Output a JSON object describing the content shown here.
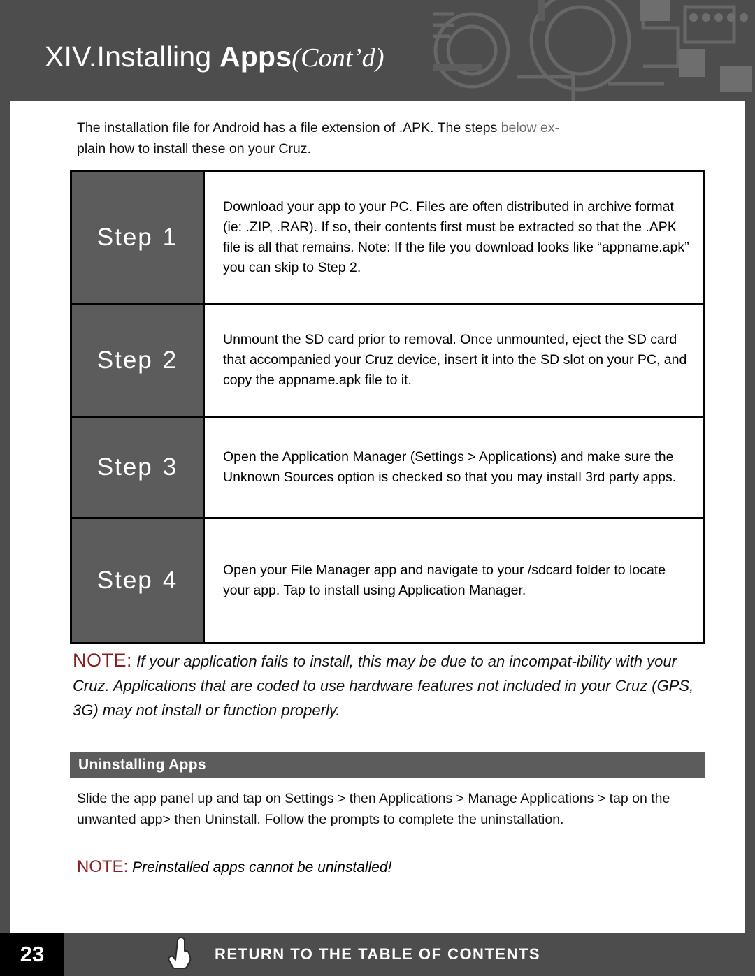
{
  "header": {
    "chapter_number": "XIV.",
    "title_main": "Installing ",
    "title_bold": "Apps",
    "title_italic": "(Cont’d)"
  },
  "intro": {
    "text_part1": "The installation file for Android has a file extension of .APK. The steps ",
    "text_grey": "below ex-",
    "text_part2": "plain how to install these on your Cruz."
  },
  "steps": [
    {
      "label_word": "Step",
      "label_number": "1",
      "text": "Download your app to your PC. Files are often distributed in archive format (ie: .ZIP, .RAR). If so, their contents first must be extracted so that the .APK file is all that remains. Note: If the file you download looks like “appname.apk” you can skip to Step 2."
    },
    {
      "label_word": "Step",
      "label_number": "2",
      "text": "Unmount the SD card prior to removal. Once unmounted, eject the SD card that accompanied your Cruz device, insert it into the SD slot on your PC, and copy the appname.apk file to it."
    },
    {
      "label_word": "Step",
      "label_number": "3",
      "text": "Open the Application Manager (Settings > Applications) and make sure the Unknown Sources option is checked so that you may install 3rd party apps."
    },
    {
      "label_word": "Step",
      "label_number": "4",
      "text": "Open your File Manager app and navigate to your /sdcard folder to locate your app. Tap to install using Application Manager."
    }
  ],
  "note_block": {
    "label": "NOTE:",
    "text": " If your application fails to install, this may be due to an incompat-ibility with your Cruz. Applications that are coded to use hardware features not included in your Cruz (GPS, 3G) may not install or function properly."
  },
  "subsection": {
    "title": "Uninstalling Apps",
    "body": "Slide the app panel up and tap on Settings > then Applications > Manage Applications > tap on the unwanted app> then Uninstall. Follow the prompts to complete the uninstallation."
  },
  "note2": {
    "label": "NOTE:",
    "text": " Preinstalled apps cannot be uninstalled!"
  },
  "footer": {
    "page_number": "23",
    "link_label": "RETURN TO THE TABLE OF CONTENTS"
  },
  "colors": {
    "header_band": "#4d4d4d",
    "step_label_bg": "#5c5c5c",
    "note_red": "#8c1d1d",
    "page_num_bg": "#000000"
  }
}
